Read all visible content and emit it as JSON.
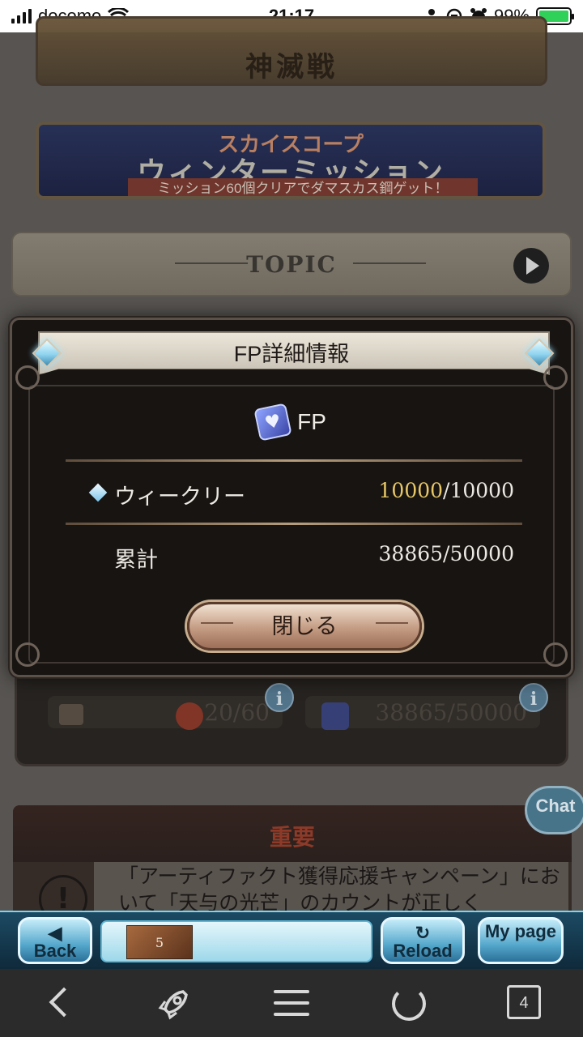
{
  "status_bar": {
    "carrier": "docomo",
    "time": "21:17",
    "battery": "99%",
    "battery_level": 0.99
  },
  "background": {
    "banner_event_title": "神滅戦",
    "banner_mission_logo": "スカイスコープ",
    "banner_mission_title": "ウィンターミッション",
    "banner_mission_sub": "ミッション60個クリアでダマスカス鋼ゲット！",
    "topic_label": "TOPIC",
    "stats": {
      "renown": "20/60",
      "fp_total": "38865/50000"
    },
    "important": {
      "heading": "重要",
      "body": "「アーティファクト獲得応援キャンペーン」において「天与の光芒」のカウントが正しく"
    },
    "chat_label": "Chat"
  },
  "modal": {
    "title": "FP詳細情報",
    "currency_label": "FP",
    "rows": [
      {
        "label": "ウィークリー",
        "current": "10000",
        "max": "/10000"
      },
      {
        "label": "累計",
        "value": "38865/50000"
      }
    ],
    "close_label": "閉じる"
  },
  "game_nav": {
    "back_label": "Back",
    "reload_label": "Reload",
    "mypage_label": "My page",
    "item_count": "5"
  },
  "browser_toolbar": {
    "tab_count": "4"
  },
  "colors": {
    "weekly_current": "#e7c766",
    "modal_bg": "#171412",
    "game_bar": "#1c4a63"
  }
}
